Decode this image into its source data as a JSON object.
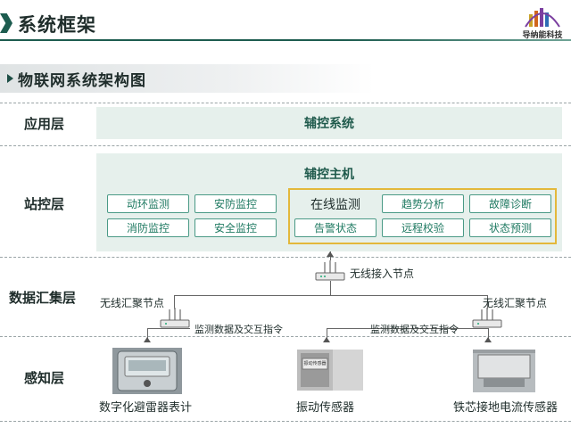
{
  "header": {
    "title": "系统框架",
    "logo_text": "导纳能科技",
    "logo_subtext": "DAO NA NENG TECHNOLOGY",
    "accent_color": "#1d5c4f"
  },
  "section": {
    "title": "物联网系统架构图"
  },
  "layers": {
    "application": "应用层",
    "station": "站控层",
    "data": "数据汇集层",
    "sensing": "感知层"
  },
  "application": {
    "system": "辅控系统"
  },
  "station": {
    "host": "辅控主机",
    "left_modules": [
      "动环监测",
      "安防监控",
      "消防监控",
      "安全监控"
    ],
    "online_title": "在线监测",
    "online_modules": [
      "趋势分析",
      "故障诊断",
      "告警状态",
      "远程校验",
      "状态预测"
    ]
  },
  "data_layer": {
    "access_node": "无线接入节点",
    "left_node": "无线汇聚节点",
    "right_node": "无线汇聚节点",
    "left_link": "监测数据及交互指令",
    "right_link": "监测数据及交互指令"
  },
  "sensing": {
    "sensors": [
      "数字化避雷器表计",
      "振动传感器",
      "铁芯接地电流传感器"
    ],
    "vibration_plate": "振动传感器"
  }
}
